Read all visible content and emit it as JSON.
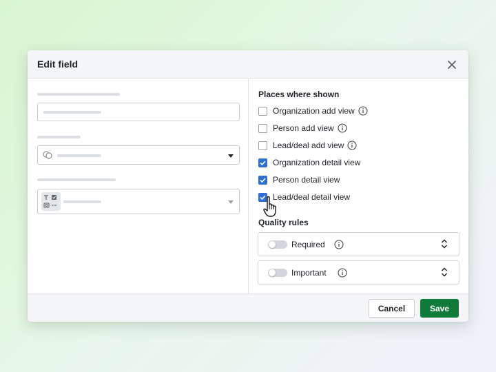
{
  "dialog": {
    "title": "Edit field",
    "close_icon": "close-icon"
  },
  "places": {
    "title": "Places where shown",
    "items": [
      {
        "label": "Organization add view",
        "checked": false,
        "has_info": true
      },
      {
        "label": "Person add view",
        "checked": false,
        "has_info": true
      },
      {
        "label": "Lead/deal add view",
        "checked": false,
        "has_info": true
      },
      {
        "label": "Organization detail view",
        "checked": true,
        "has_info": false
      },
      {
        "label": "Person detail view",
        "checked": true,
        "has_info": false
      },
      {
        "label": "Lead/deal detail view",
        "checked": true,
        "has_info": false
      }
    ]
  },
  "quality": {
    "title": "Quality rules",
    "rules": [
      {
        "label": "Required",
        "enabled": false
      },
      {
        "label": "Important",
        "enabled": false
      }
    ]
  },
  "footer": {
    "cancel_label": "Cancel",
    "save_label": "Save"
  },
  "colors": {
    "accent": "#2f6fd8",
    "save": "#0f7a3a"
  }
}
